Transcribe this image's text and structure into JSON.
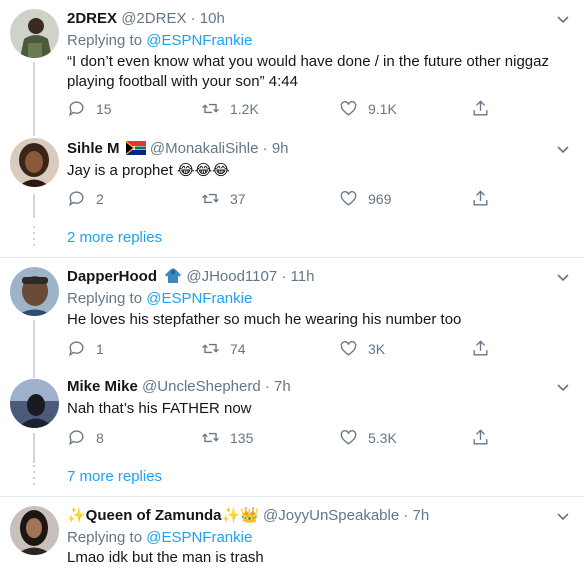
{
  "tweets": [
    {
      "name": "2DREX",
      "handle": "@2DREX",
      "sep": "·",
      "time": "10h",
      "replying_label": "Replying to ",
      "replying_to": "@ESPNFrankie",
      "text": "“I don’t even know what you would have done / in the future other niggaz playing football with your son” 4:44",
      "replies": "15",
      "retweets": "1.2K",
      "likes": "9.1K"
    },
    {
      "name": "Sihle M",
      "handle": "@MonakaliSihle",
      "sep": "·",
      "time": "9h",
      "text": "Jay is a prophet 😂😂😂",
      "replies": "2",
      "retweets": "37",
      "likes": "969"
    },
    {
      "name": "DapperHood",
      "handle": "@JHood1107",
      "sep": "·",
      "time": "11h",
      "replying_label": "Replying to ",
      "replying_to": "@ESPNFrankie",
      "text": "He loves his stepfather so much he wearing his number too",
      "replies": "1",
      "retweets": "74",
      "likes": "3K"
    },
    {
      "name": "Mike Mike",
      "handle": "@UncleShepherd",
      "sep": "·",
      "time": "7h",
      "text": "Nah that’s his FATHER now",
      "replies": "8",
      "retweets": "135",
      "likes": "5.3K"
    },
    {
      "name": "✨Queen of Zamunda✨👑",
      "handle": "@JoyyUnSpeakable",
      "sep": "·",
      "time": "7h",
      "replying_label": "Replying to ",
      "replying_to": "@ESPNFrankie",
      "text": "Lmao idk but the man is trash"
    }
  ],
  "more_replies": [
    "2 more replies",
    "7 more replies"
  ],
  "colors": {
    "link": "#1da1f2",
    "muted": "#657786",
    "border": "#e6ecf0",
    "thread": "#ccd6dd"
  }
}
